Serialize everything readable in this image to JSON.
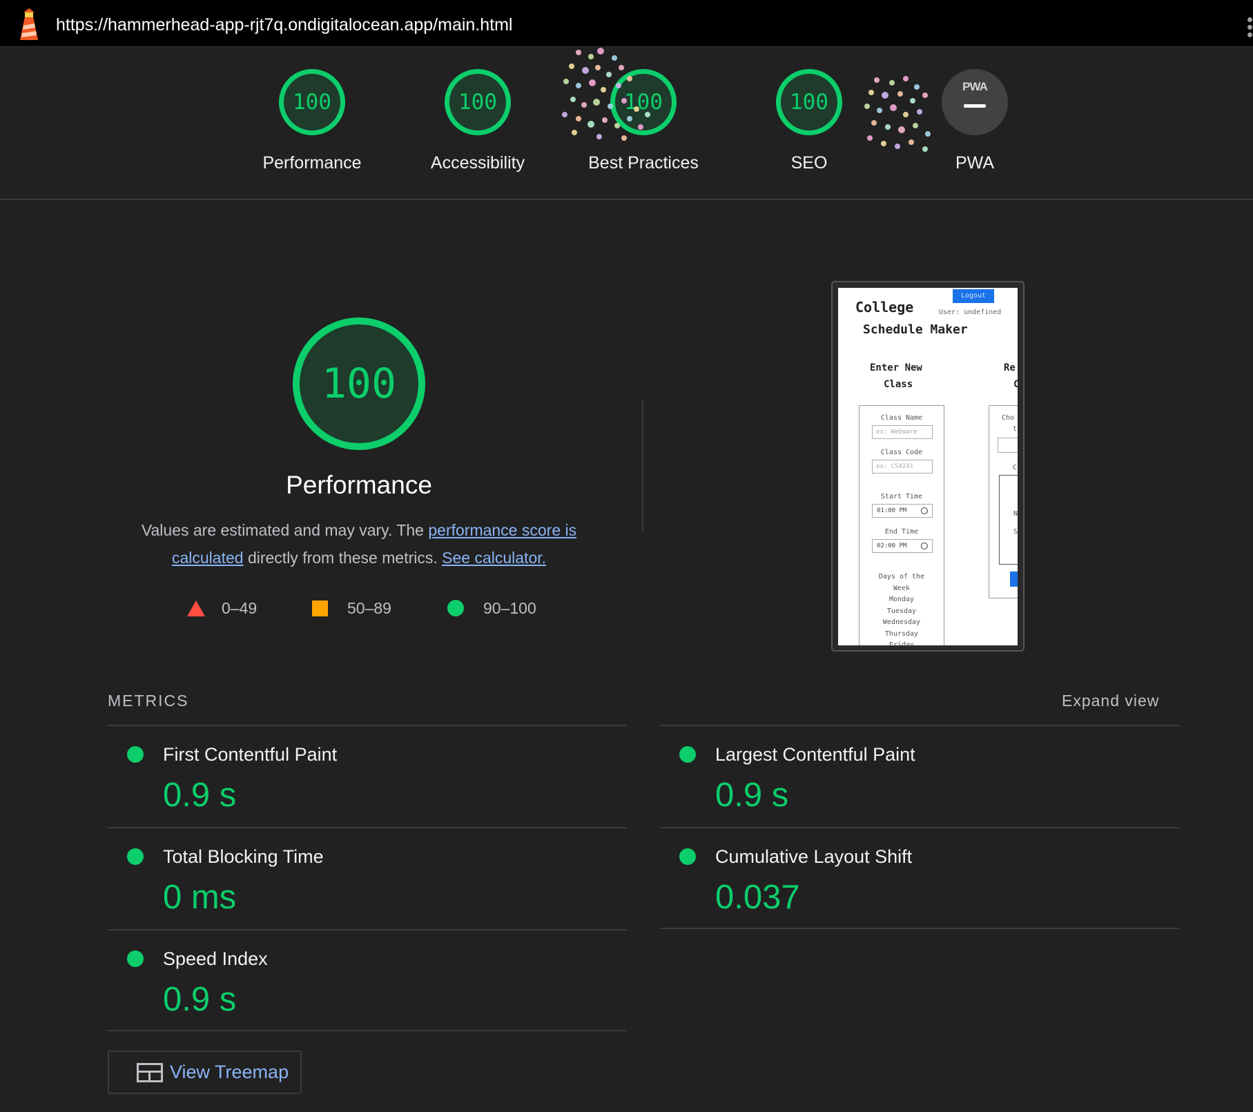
{
  "topbar": {
    "url": "https://hammerhead-app-rjt7q.ondigitalocean.app/main.html"
  },
  "gauges": [
    {
      "label": "Performance",
      "score": "100"
    },
    {
      "label": "Accessibility",
      "score": "100"
    },
    {
      "label": "Best Practices",
      "score": "100"
    },
    {
      "label": "SEO",
      "score": "100"
    },
    {
      "label": "PWA",
      "badge": "PWA"
    }
  ],
  "performance": {
    "score": "100",
    "title": "Performance",
    "desc_prefix": "Values are estimated and may vary. The ",
    "desc_link1": "performance score is calculated",
    "desc_middle": " directly from these metrics. ",
    "desc_link2": "See calculator.",
    "legend": {
      "fail": "0–49",
      "average": "50–89",
      "pass": "90–100"
    }
  },
  "screenshot": {
    "logout": "Logout",
    "title_line1": "College",
    "title_line2": "Schedule Maker",
    "user": "User: undefined",
    "enter_line1": "Enter New",
    "enter_line2": "Class",
    "right_heading1": "Re",
    "right_heading2": "C",
    "class_name_label": "Class Name",
    "class_name_placeholder": "ex: Webware",
    "class_code_label": "Class Code",
    "class_code_placeholder": "ex: CS4241",
    "start_label": "Start Time",
    "start_value": "01:00 PM",
    "end_label": "End Time",
    "end_value": "02:00 PM",
    "days_line1": "Days of the",
    "days_line2": "Week",
    "days": [
      "Monday",
      "Tuesday",
      "Wednesday",
      "Thursday",
      "Friday"
    ],
    "right_frag1": "Cho",
    "right_frag2": "t",
    "right_frag3": "C",
    "right_frag4": "N",
    "right_frag5": "S"
  },
  "metrics": {
    "heading": "METRICS",
    "expand": "Expand view",
    "items": [
      {
        "title": "First Contentful Paint",
        "value": "0.9 s"
      },
      {
        "title": "Largest Contentful Paint",
        "value": "0.9 s"
      },
      {
        "title": "Total Blocking Time",
        "value": "0 ms"
      },
      {
        "title": "Cumulative Layout Shift",
        "value": "0.037"
      },
      {
        "title": "Speed Index",
        "value": "0.9 s"
      }
    ],
    "treemap_label": "View Treemap"
  },
  "colors": {
    "pass": "#0cce6b",
    "average": "#ffa400",
    "fail": "#ff4e42",
    "link": "#8ab4f8",
    "background": "#212121"
  },
  "icons": {
    "logo": "lighthouse-icon",
    "menu": "kebab-menu-icon",
    "treemap": "treemap-icon",
    "clock": "clock-icon"
  }
}
